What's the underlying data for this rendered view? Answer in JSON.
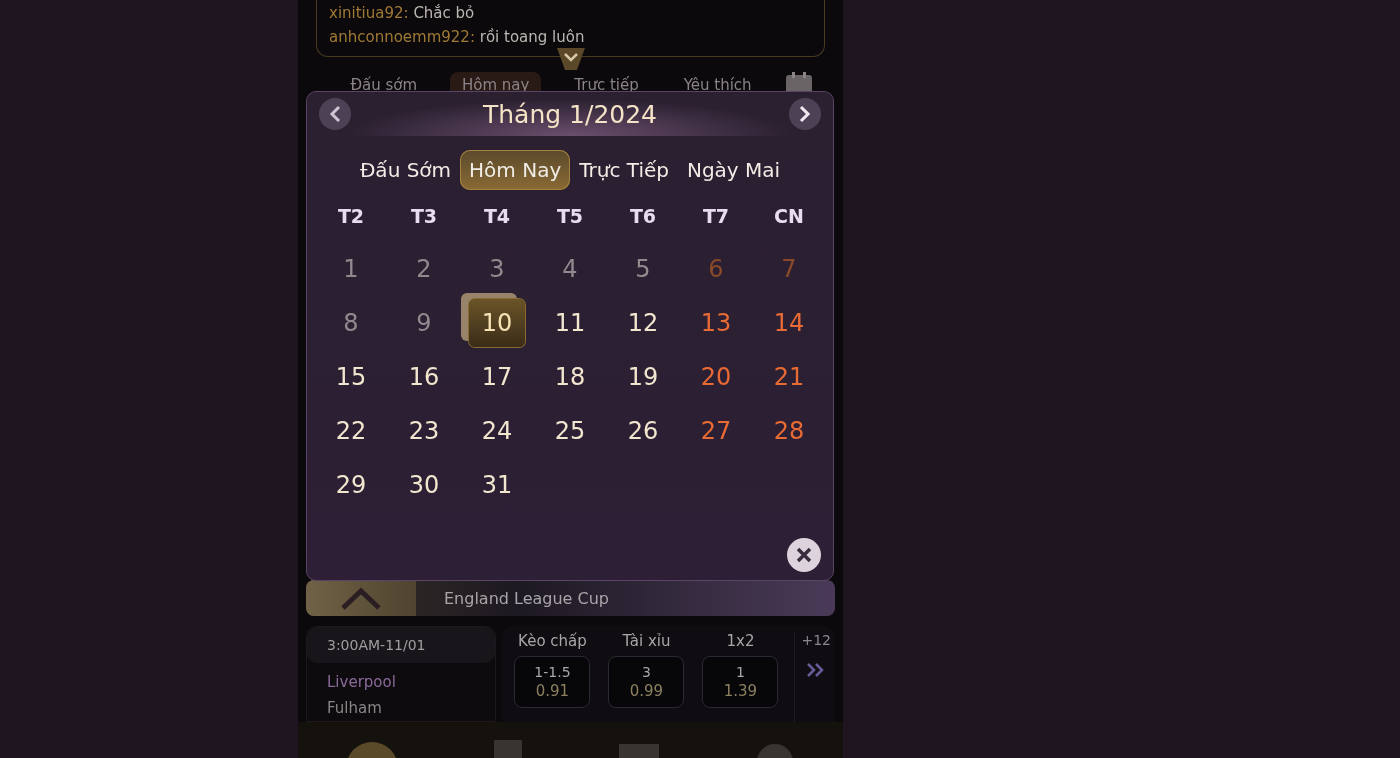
{
  "chat": [
    {
      "user": "xinitiua92:",
      "text": "Chắc bỏ"
    },
    {
      "user": "anhconnoemm922:",
      "text": "rồi toang luôn"
    }
  ],
  "tabs": [
    {
      "label": "Đấu sớm",
      "selected": false
    },
    {
      "label": "Hôm nay",
      "selected": true
    },
    {
      "label": "Trực tiếp",
      "selected": false
    },
    {
      "label": "Yêu thích",
      "selected": false
    }
  ],
  "calendar": {
    "title": "Tháng 1/2024",
    "filters": [
      {
        "label": "Đấu Sớm",
        "selected": false
      },
      {
        "label": "Hôm Nay",
        "selected": true
      },
      {
        "label": "Trực Tiếp",
        "selected": false
      },
      {
        "label": "Ngày Mai",
        "selected": false
      }
    ],
    "weekdays": [
      "T2",
      "T3",
      "T4",
      "T5",
      "T6",
      "T7",
      "CN"
    ],
    "days": [
      {
        "label": "1",
        "past": true,
        "weekend": false,
        "selected": false
      },
      {
        "label": "2",
        "past": true,
        "weekend": false,
        "selected": false
      },
      {
        "label": "3",
        "past": true,
        "weekend": false,
        "selected": false
      },
      {
        "label": "4",
        "past": true,
        "weekend": false,
        "selected": false
      },
      {
        "label": "5",
        "past": true,
        "weekend": false,
        "selected": false
      },
      {
        "label": "6",
        "past": true,
        "weekend": true,
        "selected": false
      },
      {
        "label": "7",
        "past": true,
        "weekend": true,
        "selected": false
      },
      {
        "label": "8",
        "past": true,
        "weekend": false,
        "selected": false
      },
      {
        "label": "9",
        "past": true,
        "weekend": false,
        "selected": false
      },
      {
        "label": "10",
        "past": false,
        "weekend": false,
        "selected": true
      },
      {
        "label": "11",
        "past": false,
        "weekend": false,
        "selected": false
      },
      {
        "label": "12",
        "past": false,
        "weekend": false,
        "selected": false
      },
      {
        "label": "13",
        "past": false,
        "weekend": true,
        "selected": false
      },
      {
        "label": "14",
        "past": false,
        "weekend": true,
        "selected": false
      },
      {
        "label": "15",
        "past": false,
        "weekend": false,
        "selected": false
      },
      {
        "label": "16",
        "past": false,
        "weekend": false,
        "selected": false
      },
      {
        "label": "17",
        "past": false,
        "weekend": false,
        "selected": false
      },
      {
        "label": "18",
        "past": false,
        "weekend": false,
        "selected": false
      },
      {
        "label": "19",
        "past": false,
        "weekend": false,
        "selected": false
      },
      {
        "label": "20",
        "past": false,
        "weekend": true,
        "selected": false
      },
      {
        "label": "21",
        "past": false,
        "weekend": true,
        "selected": false
      },
      {
        "label": "22",
        "past": false,
        "weekend": false,
        "selected": false
      },
      {
        "label": "23",
        "past": false,
        "weekend": false,
        "selected": false
      },
      {
        "label": "24",
        "past": false,
        "weekend": false,
        "selected": false
      },
      {
        "label": "25",
        "past": false,
        "weekend": false,
        "selected": false
      },
      {
        "label": "26",
        "past": false,
        "weekend": false,
        "selected": false
      },
      {
        "label": "27",
        "past": false,
        "weekend": true,
        "selected": false
      },
      {
        "label": "28",
        "past": false,
        "weekend": true,
        "selected": false
      },
      {
        "label": "29",
        "past": false,
        "weekend": false,
        "selected": false
      },
      {
        "label": "30",
        "past": false,
        "weekend": false,
        "selected": false
      },
      {
        "label": "31",
        "past": false,
        "weekend": false,
        "selected": false
      }
    ]
  },
  "league": "England League Cup",
  "match": {
    "time": "3:00AM-11/01",
    "home": "Liverpool",
    "away": "Fulham",
    "markets": [
      {
        "name": "Kèo chấp",
        "line": "1-1.5",
        "odds": "0.91"
      },
      {
        "name": "Tài xỉu",
        "line": "3",
        "odds": "0.99"
      },
      {
        "name": "1x2",
        "line": "1",
        "odds": "1.39"
      }
    ],
    "more": "+12"
  }
}
